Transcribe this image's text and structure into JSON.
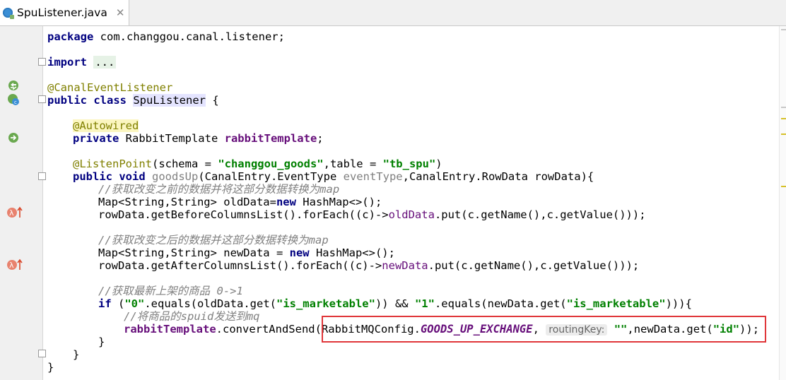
{
  "tab": {
    "label": "SpuListener.java",
    "close": "✕"
  },
  "code": {
    "l1": {
      "kw": "package",
      "rest": " com.changgou.canal.listener;"
    },
    "l2": {
      "kw": "import",
      "dots": "..."
    },
    "l3": {
      "an": "@CanalEventListener"
    },
    "l4": {
      "kw": "public class",
      "name": "SpuListener",
      "rest": " {"
    },
    "l5": {
      "an": "@Autowired"
    },
    "l6": {
      "kw": "private",
      "type": " RabbitTemplate ",
      "fld": "rabbitTemplate",
      "end": ";"
    },
    "l7": {
      "an": "@ListenPoint",
      "a": "(schema = ",
      "s1": "\"changgou_goods\"",
      "b": ",table = ",
      "s2": "\"tb_spu\"",
      "c": ")"
    },
    "l8": {
      "kw": "public void",
      "mth": " goodsUp",
      "a": "(CanalEntry.EventType ",
      "p": "eventType",
      "b": ",CanalEntry.RowData rowData){"
    },
    "l9": {
      "cm": "//获取改变之前的数据并将这部分数据转换为map"
    },
    "l10": {
      "a": "Map<String,String> oldData=",
      "kw": "new",
      "b": " HashMap<>();"
    },
    "l11": {
      "a": "rowData.getBeforeColumnsList().forEach((c)->",
      "f": "oldData",
      "b": ".put(c.getName(),c.getValue()));"
    },
    "l12": {
      "cm": "//获取改变之后的数据并这部分数据转换为map"
    },
    "l13": {
      "a": "Map<String,String> newData = ",
      "kw": "new",
      "b": " HashMap<>();"
    },
    "l14": {
      "a": "rowData.getAfterColumnsList().forEach((c)->",
      "f": "newData",
      "b": ".put(c.getName(),c.getValue()));"
    },
    "l15": {
      "cm": "//获取最新上架的商品 0->1"
    },
    "l16": {
      "kw": "if",
      "a": " (",
      "s1": "\"0\"",
      "b": ".equals(oldData.get(",
      "s2": "\"is_marketable\"",
      "c": ")) && ",
      "s3": "\"1\"",
      "d": ".equals(newData.get(",
      "s4": "\"is_marketable\"",
      "e": "))){"
    },
    "l17": {
      "cm": "//将商品的spuid发送到mq"
    },
    "l18": {
      "fld": "rabbitTemplate",
      "a": ".convertAndSend(",
      "cls": "RabbitMQConfig.",
      "const": "GOODS_UP_EXCHANGE",
      "b": ", ",
      "hint": "routingKey:",
      "s1": "\"\"",
      "c": ",newData.get(",
      "s2": "\"id\"",
      "d": "));"
    },
    "l19": {
      "t": "}"
    },
    "l20": {
      "t": "}"
    },
    "l21": {
      "t": "}"
    }
  },
  "gutter_icons": [
    "spring-bean-icon",
    "class-bean-icon",
    "autowired-bean-icon",
    "lambda-icon",
    "lambda-icon"
  ],
  "colors": {
    "keyword": "#000080",
    "annotation": "#808000",
    "comment": "#808080",
    "string": "#008000",
    "field": "#660e7a",
    "highlight_box": "#e0363a"
  }
}
